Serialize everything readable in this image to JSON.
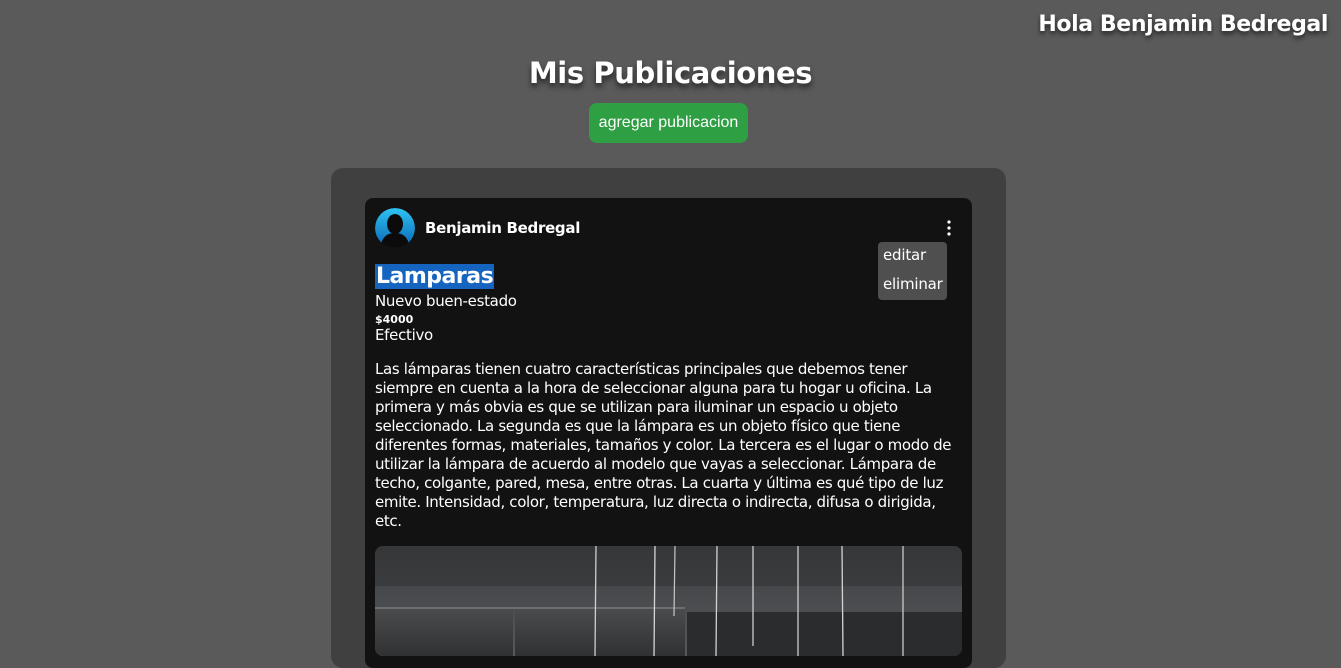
{
  "header": {
    "greeting": "Hola Benjamin Bedregal"
  },
  "page": {
    "title": "Mis Publicaciones",
    "add_button_label": "agregar publicacion"
  },
  "post": {
    "author": "Benjamin Bedregal",
    "title": "Lamparas",
    "condition": "Nuevo buen-estado",
    "price": "$4000",
    "payment": "Efectivo",
    "description": "Las lámparas tienen cuatro características principales que debemos tener siempre en cuenta a la hora de seleccionar alguna para tu hogar u oficina. La primera y más obvia es que se utilizan para iluminar un espacio u objeto seleccionado. La segunda es que la lámpara es un objeto físico que tiene diferentes formas, materiales, tamaños y color. La tercera es el lugar o modo de utilizar la lámpara de acuerdo al modelo que vayas a seleccionar. Lámpara de techo, colgante, pared, mesa, entre otras. La cuarta y última es qué tipo de luz emite. Intensidad, color, temperatura, luz directa o indirecta, difusa o dirigida, etc.",
    "menu": {
      "edit_label": "editar",
      "delete_label": "eliminar"
    }
  },
  "icons": {
    "avatar": "user-avatar-icon",
    "options": "kebab-menu-icon"
  },
  "colors": {
    "background": "#5a5a5a",
    "panel": "#404040",
    "card": "#121212",
    "add_button": "#2ea043",
    "selection_highlight": "#1565c0",
    "menu": "#4f4f4f"
  }
}
